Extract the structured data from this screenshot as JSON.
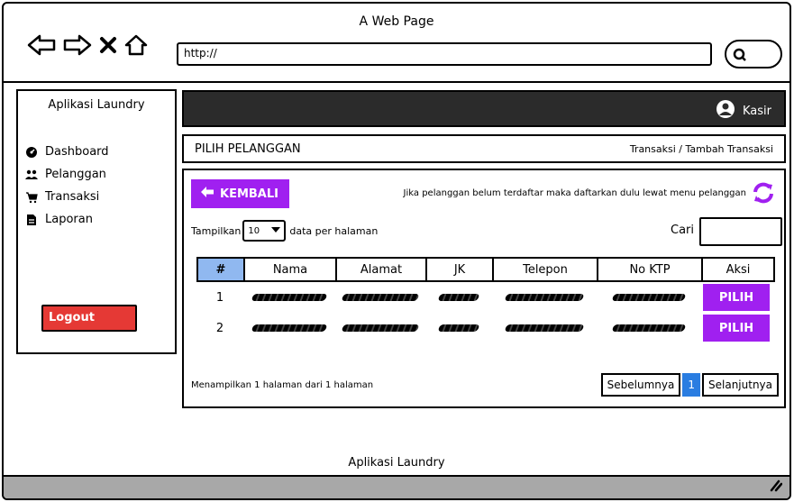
{
  "window": {
    "title": "A Web Page",
    "url": "http://"
  },
  "sidebar": {
    "title": "Aplikasi Laundry",
    "items": [
      {
        "label": "Dashboard",
        "icon": "dashboard-icon"
      },
      {
        "label": "Pelanggan",
        "icon": "users-icon"
      },
      {
        "label": "Transaksi",
        "icon": "cart-icon"
      },
      {
        "label": "Laporan",
        "icon": "document-icon"
      }
    ],
    "logout_label": "Logout"
  },
  "topbar": {
    "user_label": "Kasir"
  },
  "page": {
    "title": "PILIH PELANGGAN",
    "breadcrumb": "Transaksi / Tambah Transaksi",
    "back_label": "KEMBALI",
    "info_text": "Jika pelanggan belum terdaftar maka daftarkan dulu lewat menu pelanggan"
  },
  "table_controls": {
    "show_label": "Tampilkan",
    "per_page_value": "10",
    "per_page_suffix": "data per halaman",
    "search_label": "Cari"
  },
  "table": {
    "headers": [
      "#",
      "Nama",
      "Alamat",
      "JK",
      "Telepon",
      "No KTP",
      "Aksi"
    ],
    "rows": [
      {
        "no": "1",
        "action": "PILIH"
      },
      {
        "no": "2",
        "action": "PILIH"
      }
    ]
  },
  "pagination": {
    "info": "Menampilkan 1 halaman dari 1 halaman",
    "prev_label": "Sebelumnya",
    "current_page": "1",
    "next_label": "Selanjutnya"
  },
  "footer": {
    "text": "Aplikasi Laundry"
  },
  "colors": {
    "accent": "#a020f0",
    "topbar": "#2b2b2b",
    "logout": "#e53935",
    "page_active": "#2a7de1",
    "header_num": "#90b8f0"
  }
}
